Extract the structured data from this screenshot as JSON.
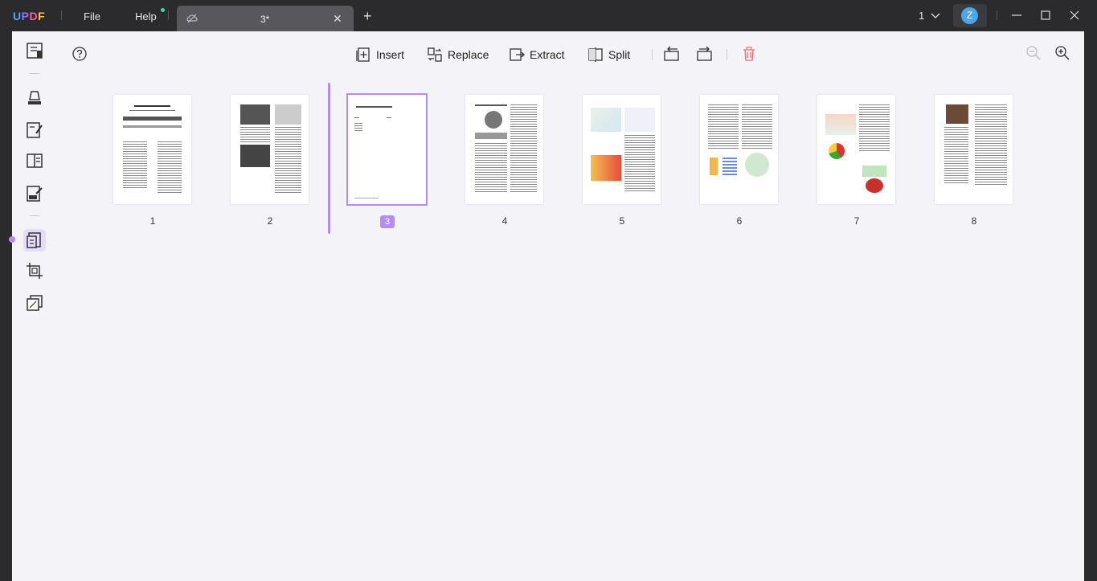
{
  "titlebar": {
    "logo": {
      "u": "U",
      "p": "P",
      "d": "D",
      "f": "F"
    },
    "menu_file": "File",
    "menu_help": "Help",
    "tab_title": "3*",
    "tab_close": "✕",
    "new_tab": "+",
    "page_count": "1",
    "avatar_letter": "Z"
  },
  "toolbar": {
    "insert": "Insert",
    "replace": "Replace",
    "extract": "Extract",
    "split": "Split"
  },
  "pages": [
    {
      "number": "1",
      "selected": false
    },
    {
      "number": "2",
      "selected": false
    },
    {
      "number": "3",
      "selected": true
    },
    {
      "number": "4",
      "selected": false
    },
    {
      "number": "5",
      "selected": false
    },
    {
      "number": "6",
      "selected": false
    },
    {
      "number": "7",
      "selected": false
    },
    {
      "number": "8",
      "selected": false
    }
  ],
  "colors": {
    "accent": "#b38cf5",
    "delete": "#f06a6a",
    "bg": "#f4f3f8",
    "chrome": "#2b2b2e"
  },
  "icons": [
    "reader-icon",
    "comment-icon",
    "edit-icon",
    "page-icon",
    "form-icon",
    "organize-icon",
    "crop-icon",
    "layers-icon",
    "help-icon",
    "insert-icon",
    "replace-icon",
    "extract-icon",
    "split-icon",
    "rotate-left-icon",
    "rotate-right-icon",
    "trash-icon",
    "zoom-out-icon",
    "zoom-in-icon"
  ]
}
